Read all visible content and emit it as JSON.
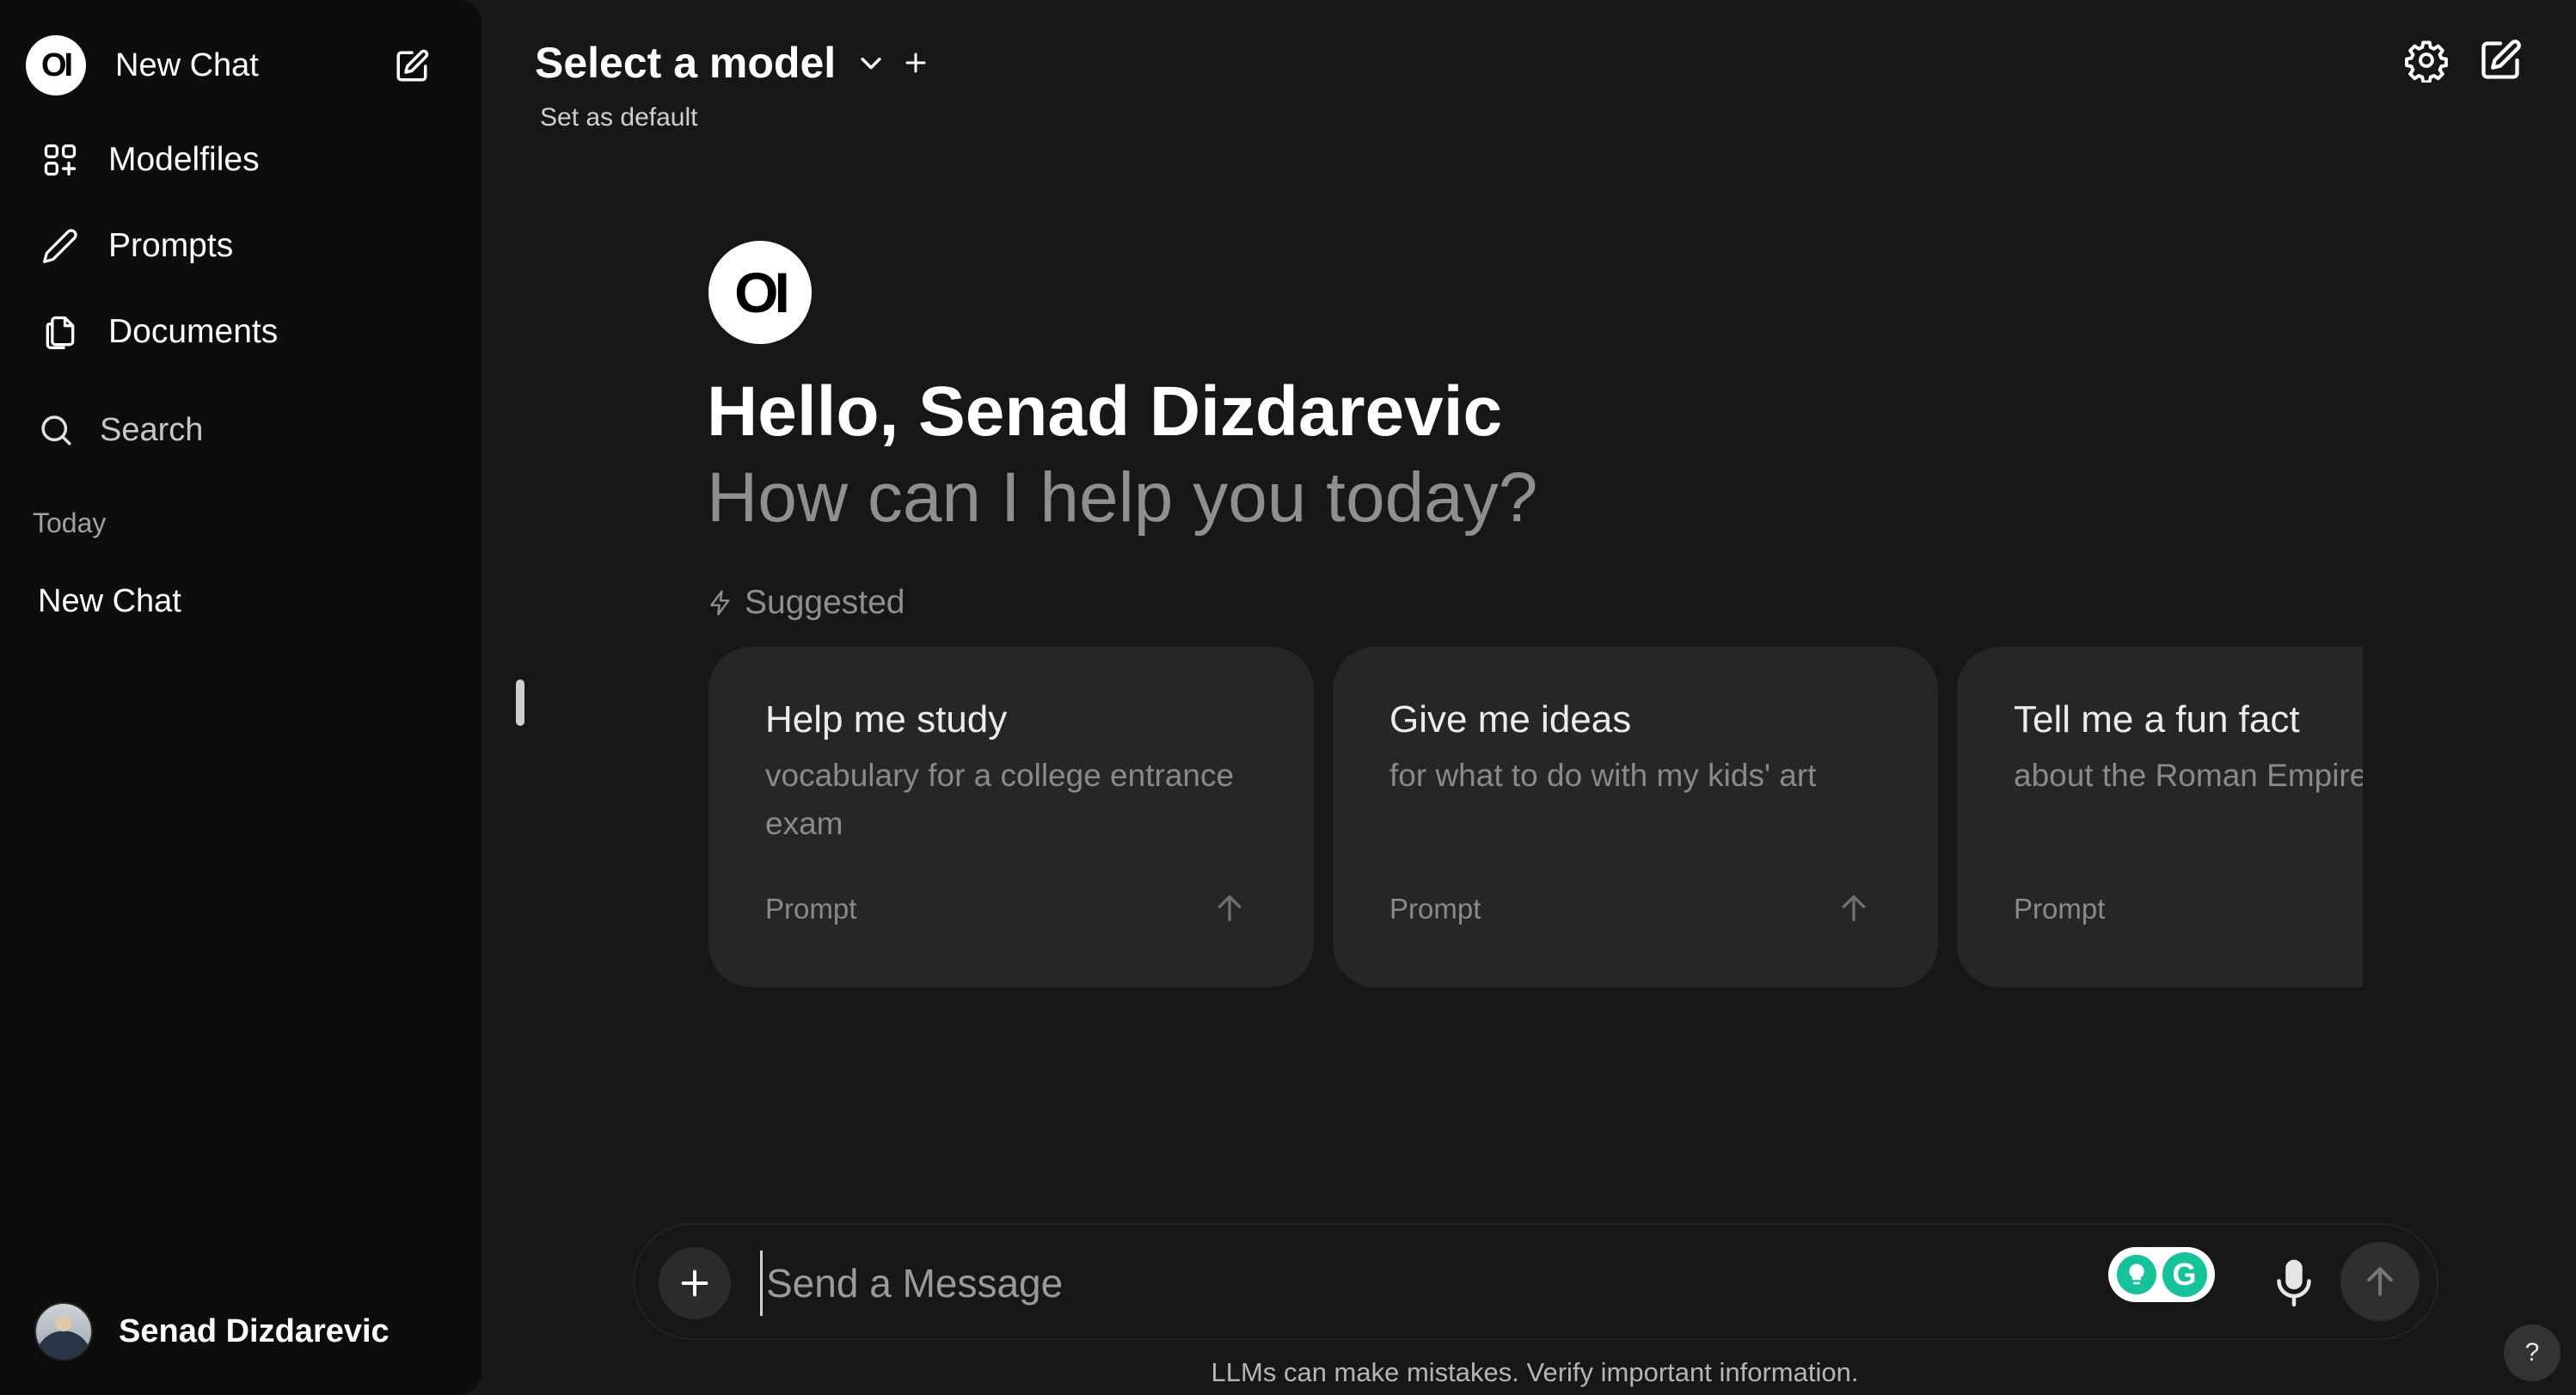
{
  "sidebar": {
    "logo_text": "OI",
    "new_chat_label": "New Chat",
    "nav": [
      {
        "label": "Modelfiles",
        "icon": "grid-plus-icon"
      },
      {
        "label": "Prompts",
        "icon": "pencil-icon"
      },
      {
        "label": "Documents",
        "icon": "documents-icon"
      }
    ],
    "search_label": "Search",
    "section_today": "Today",
    "chats": [
      "New Chat"
    ],
    "user_name": "Senad Dizdarevic"
  },
  "header": {
    "model_title": "Select a model",
    "set_default": "Set as default",
    "icons": [
      "settings-icon",
      "new-chat-icon"
    ]
  },
  "hero": {
    "logo_text": "OI",
    "greeting": "Hello, Senad Dizdarevic",
    "subtitle": "How can I help you today?",
    "suggested_label": "Suggested"
  },
  "cards": [
    {
      "title": "Help me study",
      "subtitle": "vocabulary for a college entrance exam",
      "kind": "Prompt"
    },
    {
      "title": "Give me ideas",
      "subtitle": "for what to do with my kids' art",
      "kind": "Prompt"
    },
    {
      "title": "Tell me a fun fact",
      "subtitle": "about the Roman Empire",
      "kind": "Prompt"
    }
  ],
  "composer": {
    "placeholder": "Send a Message",
    "value": ""
  },
  "footer": {
    "disclaimer": "LLMs can make mistakes. Verify important information.",
    "help_label": "?"
  },
  "colors": {
    "background": "#171717",
    "sidebar": "#0d0d0d",
    "card": "#262626",
    "muted_text": "#8f8f8f",
    "grammarly": "#15c39a"
  }
}
